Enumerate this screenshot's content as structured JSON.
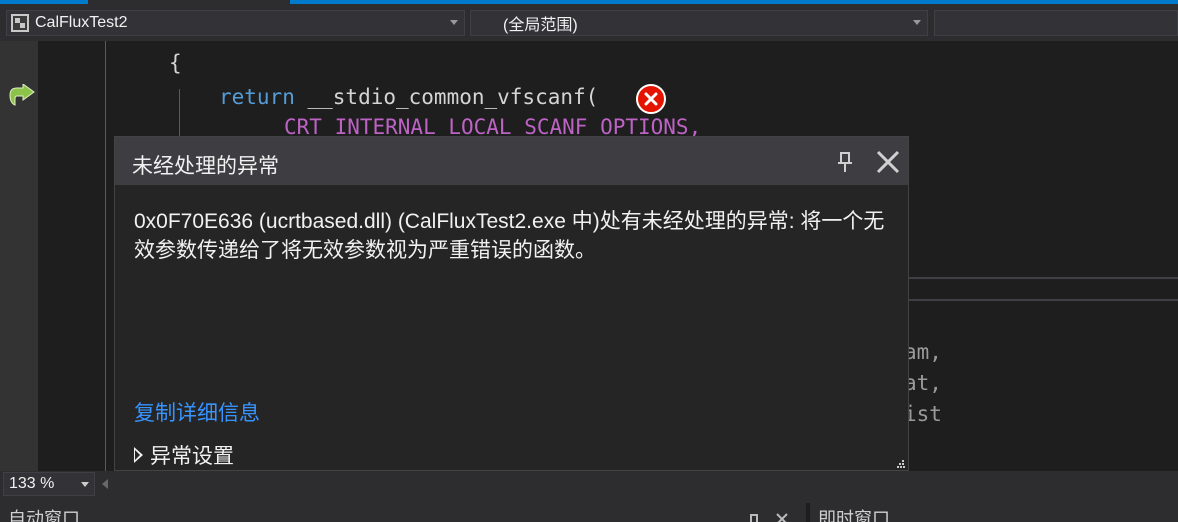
{
  "nav": {
    "project": "CalFluxTest2",
    "scope": "(全局范围)",
    "third": ""
  },
  "code": {
    "line1": "{",
    "line2_kw": "return",
    "line2_fn": " __stdio_common_vfscanf(",
    "line3": "CRT INTERNAL LOCAL SCANF OPTIONS,",
    "bg_line_a": "am,",
    "bg_line_b": "at,",
    "bg_line_c": "ist"
  },
  "popup": {
    "title": "未经处理的异常",
    "message": "0x0F70E636 (ucrtbased.dll) (CalFluxTest2.exe 中)处有未经处理的异常: 将一个无效参数传递给了将无效参数视为严重错误的函数。",
    "copy_link": "复制详细信息",
    "settings_label": "异常设置"
  },
  "zoom": {
    "value": "133 %"
  },
  "bottom": {
    "left_tab": "自动窗口",
    "right_tab": "即时窗口"
  },
  "colors": {
    "accent": "#007acc",
    "error": "#e51400",
    "link": "#3794ff"
  }
}
